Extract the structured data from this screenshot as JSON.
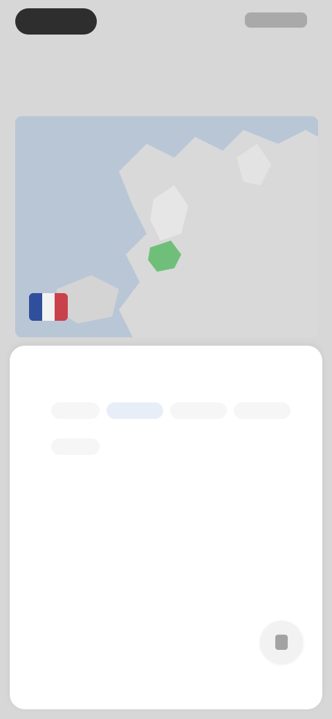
{
  "header": {
    "logo_text": "",
    "action_label": ""
  },
  "subtitle": "",
  "map": {
    "label": "",
    "sublabel": "",
    "flag_colors": [
      "#2f4f9c",
      "#f2f2f2",
      "#c9414a"
    ],
    "water_color": "#b9c6d6",
    "land_color": "#d9d9d9",
    "highlight_color": "#6fbf7a"
  },
  "sheet": {
    "title": "",
    "chips": [
      {
        "label": "",
        "active": false
      },
      {
        "label": "",
        "active": true
      },
      {
        "label": "",
        "active": false
      },
      {
        "label": "",
        "active": false
      },
      {
        "label": "",
        "active": false
      }
    ],
    "items": [
      {
        "label": ""
      },
      {
        "label": ""
      },
      {
        "label": ""
      },
      {
        "label": ""
      },
      {
        "label": ""
      }
    ],
    "fab_icon": "lock-icon"
  }
}
